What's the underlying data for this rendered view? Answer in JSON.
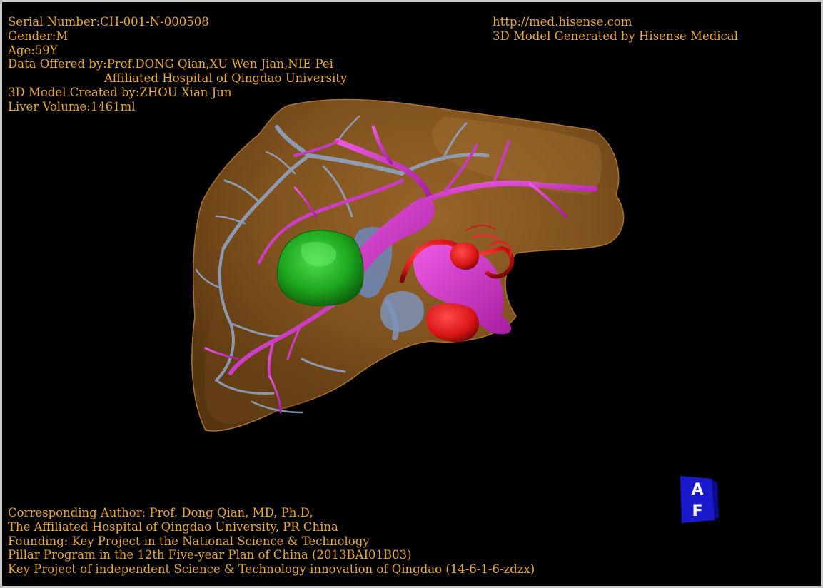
{
  "header_left": {
    "serial": "Serial Number:CH-001-N-000508",
    "gender": "Gender:M",
    "age": "Age:59Y",
    "data_offered": "Data Offered by:Prof.DONG Qian,XU Wen Jian,NIE Pei",
    "hospital": "Affiliated Hospital of Qingdao University",
    "model_created": "3D Model Created by:ZHOU Xian Jun",
    "liver_volume": "Liver Volume:1461ml"
  },
  "header_right": {
    "url": "http://med.hisense.com",
    "generated_by": "3D Model Generated by Hisense Medical"
  },
  "footer": {
    "line1": "Corresponding Author: Prof. Dong Qian, MD, Ph.D,",
    "line2": "The Affiliated Hospital of Qingdao University, PR China",
    "line3": "Founding: Key Project in the National Science & Technology",
    "line4": "Pillar Program in the 12th Five-year Plan of China (2013BAI01B03)",
    "line5": "Key Project of independent Science & Technology innovation of Qingdao (14-6-1-6-zdzx)"
  },
  "orientation_cube": {
    "top_letter": "A",
    "bottom_letter": "F"
  },
  "colors": {
    "text": "#e8a838",
    "background": "#000000",
    "liver": "#8a5a24",
    "portal_vein": "#d23ac8",
    "hepatic_vein": "#8fa3c0",
    "gallbladder": "#1ea81e",
    "artery": "#e01818",
    "cube": "#1a1acc"
  }
}
